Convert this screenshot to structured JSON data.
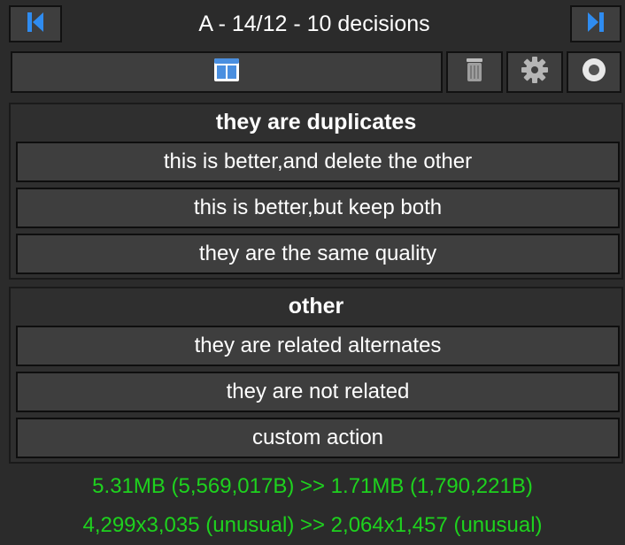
{
  "header": {
    "title": "A - 14/12 - 10 decisions",
    "prev_icon": "skip-to-first-icon",
    "next_icon": "skip-to-last-icon"
  },
  "toolbar": {
    "icons": [
      "side-by-side-view-icon",
      "trash-icon",
      "gear-icon",
      "stop-circle-icon"
    ]
  },
  "duplicates_group": {
    "title": "they are duplicates",
    "buttons": [
      "this is better,and delete the other",
      "this is better,but keep both",
      "they are the same quality"
    ]
  },
  "other_group": {
    "title": "other",
    "buttons": [
      "they are related alternates",
      "they are not related",
      "custom action"
    ]
  },
  "info": {
    "size_line": "5.31MB (5,569,017B) >> 1.71MB (1,790,221B)",
    "resolution_line": "4,299x3,035 (unusual) >> 2,064x1,457 (unusual)"
  },
  "colors": {
    "background": "#2b2b2b",
    "button": "#3e3e3e",
    "info_text": "#1ed21e",
    "nav_icon": "#2f8cf0"
  }
}
